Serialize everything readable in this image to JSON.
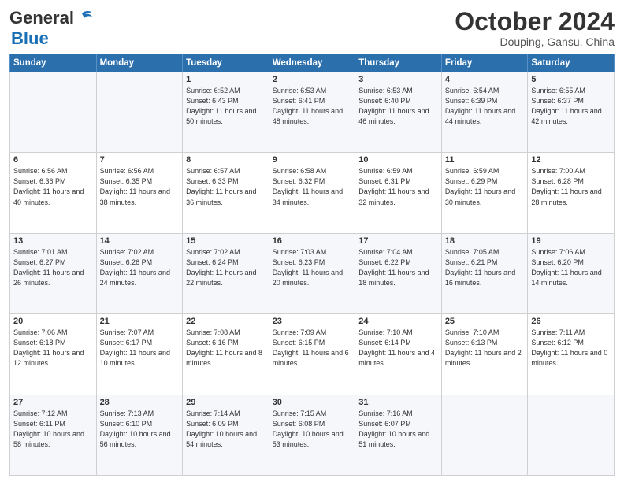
{
  "header": {
    "logo_line1": "General",
    "logo_line2": "Blue",
    "month": "October 2024",
    "location": "Douping, Gansu, China"
  },
  "weekdays": [
    "Sunday",
    "Monday",
    "Tuesday",
    "Wednesday",
    "Thursday",
    "Friday",
    "Saturday"
  ],
  "weeks": [
    [
      {
        "day": "",
        "info": ""
      },
      {
        "day": "",
        "info": ""
      },
      {
        "day": "1",
        "info": "Sunrise: 6:52 AM\nSunset: 6:43 PM\nDaylight: 11 hours and 50 minutes."
      },
      {
        "day": "2",
        "info": "Sunrise: 6:53 AM\nSunset: 6:41 PM\nDaylight: 11 hours and 48 minutes."
      },
      {
        "day": "3",
        "info": "Sunrise: 6:53 AM\nSunset: 6:40 PM\nDaylight: 11 hours and 46 minutes."
      },
      {
        "day": "4",
        "info": "Sunrise: 6:54 AM\nSunset: 6:39 PM\nDaylight: 11 hours and 44 minutes."
      },
      {
        "day": "5",
        "info": "Sunrise: 6:55 AM\nSunset: 6:37 PM\nDaylight: 11 hours and 42 minutes."
      }
    ],
    [
      {
        "day": "6",
        "info": "Sunrise: 6:56 AM\nSunset: 6:36 PM\nDaylight: 11 hours and 40 minutes."
      },
      {
        "day": "7",
        "info": "Sunrise: 6:56 AM\nSunset: 6:35 PM\nDaylight: 11 hours and 38 minutes."
      },
      {
        "day": "8",
        "info": "Sunrise: 6:57 AM\nSunset: 6:33 PM\nDaylight: 11 hours and 36 minutes."
      },
      {
        "day": "9",
        "info": "Sunrise: 6:58 AM\nSunset: 6:32 PM\nDaylight: 11 hours and 34 minutes."
      },
      {
        "day": "10",
        "info": "Sunrise: 6:59 AM\nSunset: 6:31 PM\nDaylight: 11 hours and 32 minutes."
      },
      {
        "day": "11",
        "info": "Sunrise: 6:59 AM\nSunset: 6:29 PM\nDaylight: 11 hours and 30 minutes."
      },
      {
        "day": "12",
        "info": "Sunrise: 7:00 AM\nSunset: 6:28 PM\nDaylight: 11 hours and 28 minutes."
      }
    ],
    [
      {
        "day": "13",
        "info": "Sunrise: 7:01 AM\nSunset: 6:27 PM\nDaylight: 11 hours and 26 minutes."
      },
      {
        "day": "14",
        "info": "Sunrise: 7:02 AM\nSunset: 6:26 PM\nDaylight: 11 hours and 24 minutes."
      },
      {
        "day": "15",
        "info": "Sunrise: 7:02 AM\nSunset: 6:24 PM\nDaylight: 11 hours and 22 minutes."
      },
      {
        "day": "16",
        "info": "Sunrise: 7:03 AM\nSunset: 6:23 PM\nDaylight: 11 hours and 20 minutes."
      },
      {
        "day": "17",
        "info": "Sunrise: 7:04 AM\nSunset: 6:22 PM\nDaylight: 11 hours and 18 minutes."
      },
      {
        "day": "18",
        "info": "Sunrise: 7:05 AM\nSunset: 6:21 PM\nDaylight: 11 hours and 16 minutes."
      },
      {
        "day": "19",
        "info": "Sunrise: 7:06 AM\nSunset: 6:20 PM\nDaylight: 11 hours and 14 minutes."
      }
    ],
    [
      {
        "day": "20",
        "info": "Sunrise: 7:06 AM\nSunset: 6:18 PM\nDaylight: 11 hours and 12 minutes."
      },
      {
        "day": "21",
        "info": "Sunrise: 7:07 AM\nSunset: 6:17 PM\nDaylight: 11 hours and 10 minutes."
      },
      {
        "day": "22",
        "info": "Sunrise: 7:08 AM\nSunset: 6:16 PM\nDaylight: 11 hours and 8 minutes."
      },
      {
        "day": "23",
        "info": "Sunrise: 7:09 AM\nSunset: 6:15 PM\nDaylight: 11 hours and 6 minutes."
      },
      {
        "day": "24",
        "info": "Sunrise: 7:10 AM\nSunset: 6:14 PM\nDaylight: 11 hours and 4 minutes."
      },
      {
        "day": "25",
        "info": "Sunrise: 7:10 AM\nSunset: 6:13 PM\nDaylight: 11 hours and 2 minutes."
      },
      {
        "day": "26",
        "info": "Sunrise: 7:11 AM\nSunset: 6:12 PM\nDaylight: 11 hours and 0 minutes."
      }
    ],
    [
      {
        "day": "27",
        "info": "Sunrise: 7:12 AM\nSunset: 6:11 PM\nDaylight: 10 hours and 58 minutes."
      },
      {
        "day": "28",
        "info": "Sunrise: 7:13 AM\nSunset: 6:10 PM\nDaylight: 10 hours and 56 minutes."
      },
      {
        "day": "29",
        "info": "Sunrise: 7:14 AM\nSunset: 6:09 PM\nDaylight: 10 hours and 54 minutes."
      },
      {
        "day": "30",
        "info": "Sunrise: 7:15 AM\nSunset: 6:08 PM\nDaylight: 10 hours and 53 minutes."
      },
      {
        "day": "31",
        "info": "Sunrise: 7:16 AM\nSunset: 6:07 PM\nDaylight: 10 hours and 51 minutes."
      },
      {
        "day": "",
        "info": ""
      },
      {
        "day": "",
        "info": ""
      }
    ]
  ]
}
